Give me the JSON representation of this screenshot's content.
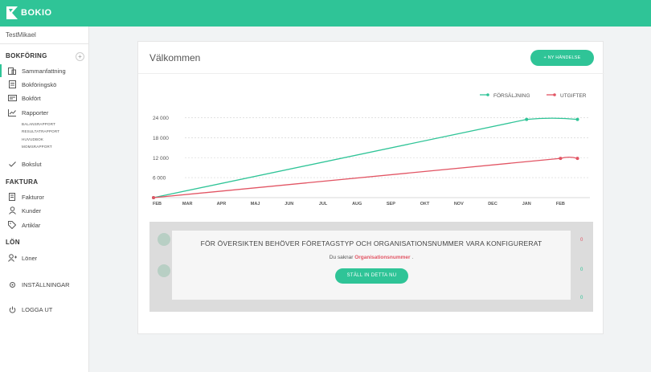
{
  "app": {
    "brand": "BOKIO"
  },
  "sidebar": {
    "user": "TestMikael",
    "bokforing_heading": "BOKFÖRING",
    "bokforing_add": "+",
    "items": [
      {
        "label": "Sammanfattning",
        "icon": "summary-icon"
      },
      {
        "label": "Bokföringskö",
        "icon": "queue-icon"
      },
      {
        "label": "Bokfört",
        "icon": "ledger-icon"
      },
      {
        "label": "Rapporter",
        "icon": "chart-icon"
      }
    ],
    "reports": [
      "BALANSRAPPORT",
      "RESULTATRAPPORT",
      "HUVUDBOK",
      "MOMSRAPPORT"
    ],
    "bokslut": "Bokslut",
    "faktura_heading": "FAKTURA",
    "faktura_items": [
      "Fakturor",
      "Kunder",
      "Artiklar"
    ],
    "lon_heading": "LÖN",
    "loner": "Löner",
    "settings": "INSTÄLLNINGAR",
    "logout": "LOGGA UT"
  },
  "main": {
    "title": "Välkommen",
    "new_event": "+ NY HÄNDELSE",
    "overlay": {
      "title": "FÖR ÖVERSIKTEN BEHÖVER FÖRETAGSTYP OCH ORGANISATIONSNUMMER VARA KONFIGURERAT",
      "missing_prefix": "Du saknar",
      "missing_field": "Organisationsnummer",
      "missing_suffix": ".",
      "button": "STÄLL IN DETTA NU"
    },
    "ghost_values": [
      "0",
      "0",
      "0"
    ]
  },
  "colors": {
    "accent": "#2fc497",
    "sales": "#2fc497",
    "expenses": "#e25564"
  },
  "chart_data": {
    "type": "line",
    "categories": [
      "FEB",
      "MAR",
      "APR",
      "MAJ",
      "JUN",
      "JUL",
      "AUG",
      "SEP",
      "OKT",
      "NOV",
      "DEC",
      "JAN",
      "FEB"
    ],
    "yticks": [
      6000,
      12000,
      18000,
      24000
    ],
    "ytick_labels": [
      "6 000",
      "12 000",
      "18 000",
      "24 000"
    ],
    "ylim": [
      0,
      28000
    ],
    "legend_position": "top-right",
    "grid": true,
    "series": [
      {
        "name": "FÖRSÄLJNING",
        "color": "#2fc497",
        "points": [
          [
            0,
            0
          ],
          [
            11,
            23500
          ],
          [
            12.5,
            23500
          ]
        ]
      },
      {
        "name": "UTGIFTER",
        "color": "#e25564",
        "points": [
          [
            0,
            0
          ],
          [
            12,
            11800
          ],
          [
            12.5,
            11800
          ]
        ]
      }
    ]
  }
}
